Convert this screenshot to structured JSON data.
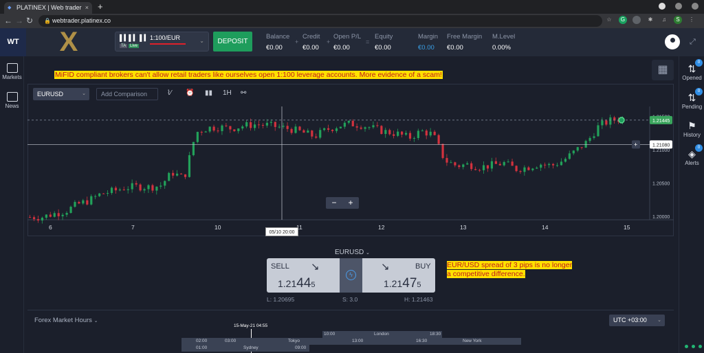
{
  "browser": {
    "tab_title": "PLATINEX | Web trader",
    "tab_close": "×",
    "new_tab": "+",
    "url": "webtrader.platinex.co",
    "ext_profile": "S"
  },
  "header": {
    "logo": "WT",
    "brand_mark": "X",
    "account": {
      "leverage": "1:100/EUR",
      "tag_ta": "TA",
      "tag_live": "Live"
    },
    "deposit_label": "DEPOSIT",
    "stats": [
      {
        "label": "Balance",
        "value": "€0.00"
      },
      {
        "label": "Credit",
        "value": "€0.00"
      },
      {
        "label": "Open P/L",
        "value": "€0.00"
      },
      {
        "label": "Equity",
        "value": "€0.00"
      },
      {
        "label": "Margin",
        "value": "€0.00"
      },
      {
        "label": "Free Margin",
        "value": "€0.00"
      },
      {
        "label": "M.Level",
        "value": "0.00%"
      }
    ],
    "operators": [
      "+",
      "+",
      "="
    ]
  },
  "leftbar": {
    "items": [
      {
        "label": "Markets"
      },
      {
        "label": "News"
      }
    ]
  },
  "rightbar": {
    "items": [
      {
        "label": "Opened",
        "badge": "0"
      },
      {
        "label": "Pending",
        "badge": "0"
      },
      {
        "label": "History"
      },
      {
        "label": "Alerts",
        "badge": "0"
      }
    ]
  },
  "annotations": {
    "top": "MiFID compliant brokers can't allow retail traders like ourselves open 1:100 leverage accounts. More evidence of a scam!",
    "spread_line1": "EUR/USD spread of 3 pips is no longer",
    "spread_line2": "a competitive difference."
  },
  "chart_toolbar": {
    "symbol": "EURUSD",
    "comparison_placeholder": "Add Comparison",
    "timeframe": "1H"
  },
  "chart_data": {
    "type": "candlestick",
    "x_ticks": [
      "6",
      "7",
      "10",
      "11",
      "12",
      "13",
      "14",
      "15"
    ],
    "y_ticks": [
      "1.21500",
      "1.21000",
      "1.20500",
      "1.20000"
    ],
    "ylim": [
      1.1995,
      1.2165
    ],
    "current_price_label": "1.21445",
    "crosshair_price_label": "1.21080",
    "crosshair_time_label": "05/10 20:00",
    "close_path": [
      1.1999,
      1.1999,
      1.2004,
      1.2008,
      1.2018,
      1.2024,
      1.2034,
      1.2038,
      1.2043,
      1.2045,
      1.2044,
      1.2046,
      1.2066,
      1.2057,
      1.2126,
      1.2133,
      1.2134,
      1.2132,
      1.2136,
      1.2138,
      1.2137,
      1.2134,
      1.2131,
      1.2126,
      1.212,
      1.213,
      1.2136,
      1.2139,
      1.2137,
      1.2132,
      1.2127,
      1.2124,
      1.2118,
      1.2128,
      1.2123,
      1.2084,
      1.2076,
      1.2078,
      1.2074,
      1.2077,
      1.208,
      1.2071,
      1.2074,
      1.2079,
      1.2076,
      1.2084,
      1.2098,
      1.2112,
      1.2136,
      1.2144,
      1.2147
    ]
  },
  "zoom": {
    "minus": "−",
    "plus": "+"
  },
  "trade": {
    "symbol": "EURUSD",
    "sell_label": "SELL",
    "sell_price_a": "1.21",
    "sell_price_b": "44",
    "sell_price_c": "5",
    "buy_label": "BUY",
    "buy_price_a": "1.21",
    "buy_price_b": "47",
    "buy_price_c": "5",
    "low": "L: 1.20695",
    "spread": "S: 3.0",
    "high": "H: 1.21463"
  },
  "market_hours": {
    "title": "Forex Market Hours",
    "timezone": "UTC +03:00",
    "now": "15-May-21 04:55",
    "sessions": [
      {
        "name": "London",
        "start": "10:00",
        "end": "18:30"
      },
      {
        "name": "Tokyo",
        "start": "03:00",
        "end": "13:00"
      },
      {
        "name": "New York",
        "start": "16:30",
        "end": ""
      },
      {
        "name": "Sydney",
        "start": "01:00",
        "end": "09:00"
      },
      {
        "name": "",
        "start": "02:00",
        "end": ""
      }
    ]
  },
  "colors": {
    "up": "#22a15a",
    "down": "#d2323e",
    "accent": "#1e9d5c",
    "annotation_bg": "#ffe100",
    "annotation_text": "#c0181c"
  }
}
